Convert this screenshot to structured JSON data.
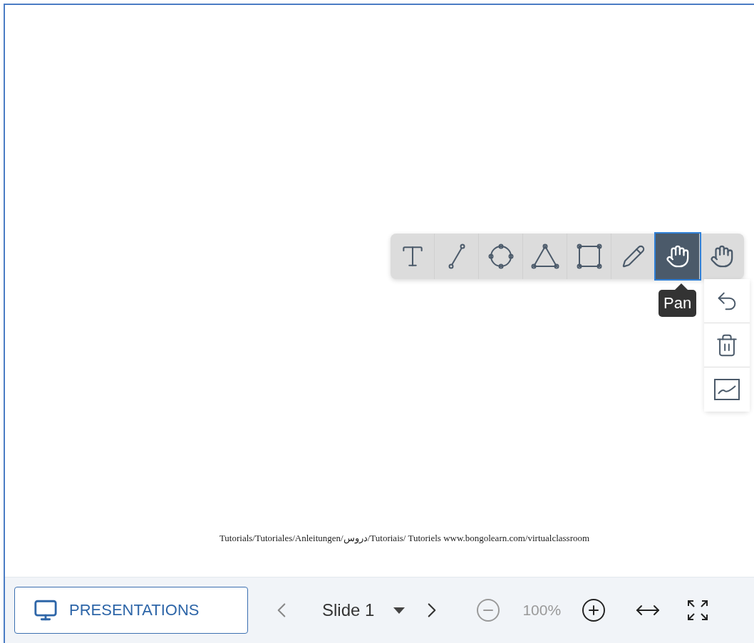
{
  "toolbar": {
    "tools": [
      {
        "kind": "text",
        "selected": false
      },
      {
        "kind": "line",
        "selected": false
      },
      {
        "kind": "ellipse",
        "selected": false
      },
      {
        "kind": "triangle",
        "selected": false
      },
      {
        "kind": "rectangle",
        "selected": false
      },
      {
        "kind": "pencil",
        "selected": false
      },
      {
        "kind": "pan",
        "selected": true
      },
      {
        "kind": "pan",
        "selected": false
      }
    ],
    "tooltip": "Pan"
  },
  "slide": {
    "footer_text": "Tutorials/Tutoriales/Anleitungen/دروس/Tutoriais/ Tutoriels www.bongolearn.com/virtualclassroom"
  },
  "bottom_bar": {
    "presentations_button": "PRESENTATIONS",
    "slide_label": "Slide 1",
    "zoom": "100%"
  }
}
